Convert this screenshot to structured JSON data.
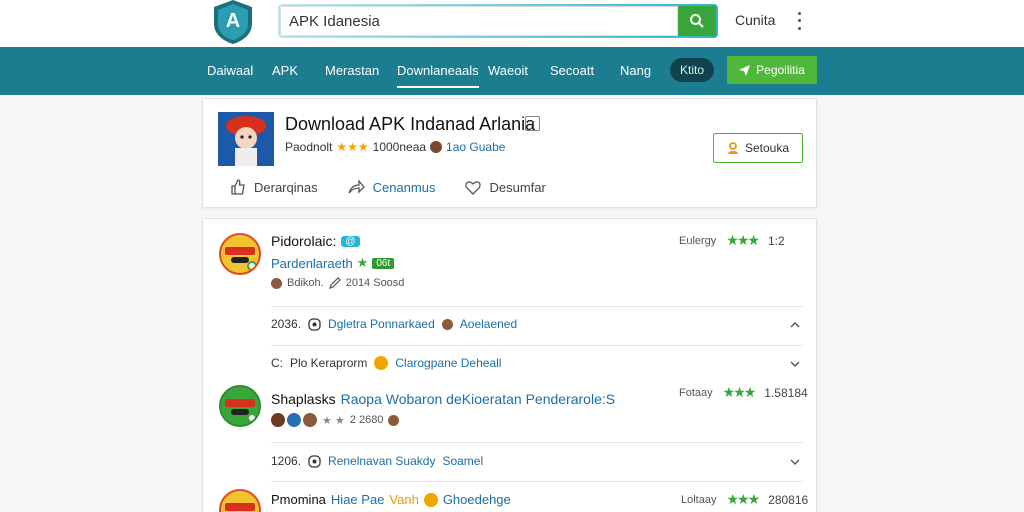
{
  "header": {
    "logo_text": "A",
    "search_value": "APK Idanesia",
    "top_link": "Cunita"
  },
  "nav": {
    "items": [
      "Daiwaal",
      "APK",
      "Merastan",
      "Downlaneaals",
      "Waeoit",
      "Secoatt",
      "Nang"
    ],
    "pill": "Ktito",
    "cta": "Pegoilitia"
  },
  "app": {
    "title": "Download APK Indanad Arlania",
    "meta_prefix": "Paodnolt",
    "meta_stars": "★★★",
    "meta_count": "1000neaa",
    "meta_link": "1ao Guabe",
    "button": "Setouka",
    "actions": [
      "Derarqinas",
      "Cenanmus",
      "Desumfar"
    ]
  },
  "list": {
    "item1": {
      "title": "Pidorolaic:",
      "badge": "@",
      "subtitle": "Pardenlaraeth",
      "sub_badge": "06t",
      "meta_author": "Bdikoh.",
      "meta_size": "2014 Soosd",
      "right_label": "Eulergy",
      "right_stars": "★★★",
      "right_score": "1:2"
    },
    "row1": {
      "prefix": "2036.",
      "link1": "Dgletra Ponnarkaed",
      "link2": "Aoelaened"
    },
    "row2": {
      "prefix": "C:",
      "text": "Plo Keraprorm",
      "link": "Clarogpane Deheall"
    },
    "item2": {
      "title": "Shaplasks",
      "subtitle": "Raopa Wobaron deKioeratan Penderarole:S",
      "meta_count": "2 2680",
      "right_label": "Fotaay",
      "right_stars": "★★★",
      "right_score": "1.58184"
    },
    "row3": {
      "prefix": "1206.",
      "link1": "Renelnavan Suakdy",
      "link2": "Soamel"
    },
    "item3": {
      "title": "Pmomina",
      "link1": "Hiae Pae",
      "link2": "Vanh",
      "link3": "Ghoedehge",
      "right_label": "Loltaay",
      "right_stars": "★★★",
      "right_score": "280816"
    }
  },
  "colors": {
    "nav_bg": "#1d7d90",
    "accent_green": "#4fb83b",
    "link_blue": "#1a6fa8"
  }
}
